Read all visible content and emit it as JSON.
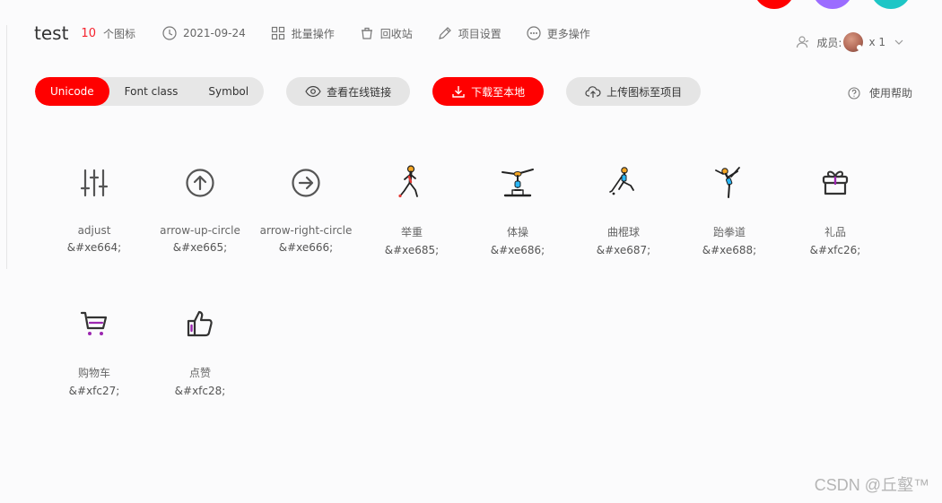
{
  "header": {
    "title": "test",
    "icon_count": "10",
    "icon_count_label": "个图标",
    "date": "2021-09-24",
    "batch_ops": "批量操作",
    "recycle_bin": "回收站",
    "project_settings": "项目设置",
    "more_ops": "更多操作"
  },
  "members": {
    "label": "成员:",
    "count": "x 1"
  },
  "toolbar": {
    "tabs": [
      "Unicode",
      "Font class",
      "Symbol"
    ],
    "active_tab": "Unicode",
    "view_online_link": "查看在线链接",
    "download_local": "下载至本地",
    "upload_to_project": "上传图标至项目",
    "help": "使用帮助"
  },
  "icons": [
    {
      "name": "adjust",
      "code": "&#xe664;",
      "icon": "adjust-icon"
    },
    {
      "name": "arrow-up-circle",
      "code": "&#xe665;",
      "icon": "arrow-up-circle-icon"
    },
    {
      "name": "arrow-right-circle",
      "code": "&#xe666;",
      "icon": "arrow-right-circle-icon"
    },
    {
      "name": "举重",
      "code": "&#xe685;",
      "icon": "weightlifting-icon"
    },
    {
      "name": "体操",
      "code": "&#xe686;",
      "icon": "gymnastics-icon"
    },
    {
      "name": "曲棍球",
      "code": "&#xe687;",
      "icon": "hockey-icon"
    },
    {
      "name": "跆拳道",
      "code": "&#xe688;",
      "icon": "taekwondo-icon"
    },
    {
      "name": "礼品",
      "code": "&#xfc26;",
      "icon": "gift-icon"
    },
    {
      "name": "购物车",
      "code": "&#xfc27;",
      "icon": "shopping-cart-icon"
    },
    {
      "name": "点赞",
      "code": "&#xfc28;",
      "icon": "thumbs-up-icon"
    }
  ],
  "colors": {
    "accent": "#ff0000",
    "corner_circles": [
      "#ff0000",
      "#9b6cff",
      "#1ec6c6"
    ]
  },
  "watermark": "CSDN @丘壑™"
}
